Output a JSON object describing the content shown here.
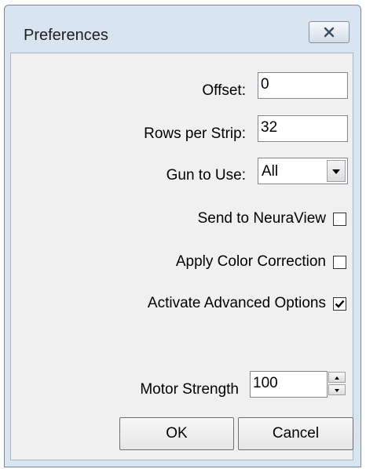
{
  "window": {
    "title": "Preferences",
    "close_icon": "close-icon"
  },
  "form": {
    "offset": {
      "label": "Offset:",
      "value": "0"
    },
    "rows_per_strip": {
      "label": "Rows per Strip:",
      "value": "32"
    },
    "gun_to_use": {
      "label": "Gun to Use:",
      "selected": "All",
      "icon": "chevron-down-icon"
    },
    "send_to_neuraview": {
      "label": "Send to NeuraView",
      "checked": false
    },
    "apply_color_correction": {
      "label": "Apply Color Correction",
      "checked": false
    },
    "activate_advanced_options": {
      "label": "Activate Advanced Options",
      "checked": true
    },
    "motor_strength": {
      "label": "Motor Strength",
      "value": "100"
    }
  },
  "buttons": {
    "ok_label": "OK",
    "cancel_label": "Cancel"
  }
}
